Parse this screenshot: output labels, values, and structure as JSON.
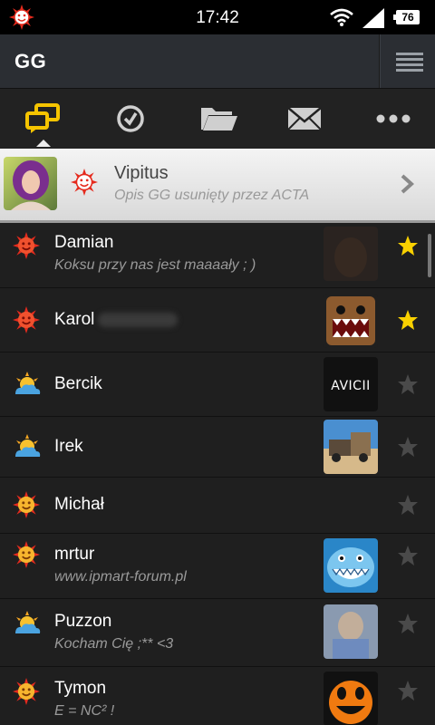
{
  "status_bar": {
    "time": "17:42",
    "battery": "76",
    "icons": [
      "gg-status-icon",
      "wifi-icon",
      "signal-icon",
      "battery-icon"
    ]
  },
  "app_bar": {
    "title": "GG",
    "menu_icon": "menu-icon"
  },
  "tabs": [
    {
      "icon": "conversations-icon",
      "active": true
    },
    {
      "icon": "history-icon",
      "active": false
    },
    {
      "icon": "folder-icon",
      "active": false
    },
    {
      "icon": "mail-icon",
      "active": false
    },
    {
      "icon": "more-icon",
      "active": false
    }
  ],
  "profile": {
    "name": "Vipitus",
    "description": "Opis GG usunięty przez ACTA"
  },
  "contacts": [
    {
      "name": "Damian",
      "description": "Koksu przy nas jest maaaały ; )",
      "status": "available",
      "favorite": true,
      "has_avatar": true
    },
    {
      "name": "Karol",
      "description": "",
      "status": "available",
      "favorite": true,
      "has_avatar": true
    },
    {
      "name": "Bercik",
      "description": "",
      "status": "away",
      "favorite": false,
      "has_avatar": true
    },
    {
      "name": "Irek",
      "description": "",
      "status": "away",
      "favorite": false,
      "has_avatar": true
    },
    {
      "name": "Michał",
      "description": "",
      "status": "available",
      "favorite": false,
      "has_avatar": false
    },
    {
      "name": "mrtur",
      "description": "www.ipmart-forum.pl",
      "status": "available",
      "favorite": false,
      "has_avatar": true
    },
    {
      "name": "Puzzon",
      "description": "Kocham Cię ;** <3",
      "status": "away",
      "favorite": false,
      "has_avatar": true
    },
    {
      "name": "Tymon",
      "description": "E = NC² !",
      "status": "available",
      "favorite": false,
      "has_avatar": true
    }
  ],
  "avatar_labels": {
    "bercik": "AVICII"
  },
  "colors": {
    "accent_yellow": "#f5c400",
    "status_red": "#e62a1d",
    "star_gold": "#f9d100",
    "star_off": "#4a4a4a"
  }
}
